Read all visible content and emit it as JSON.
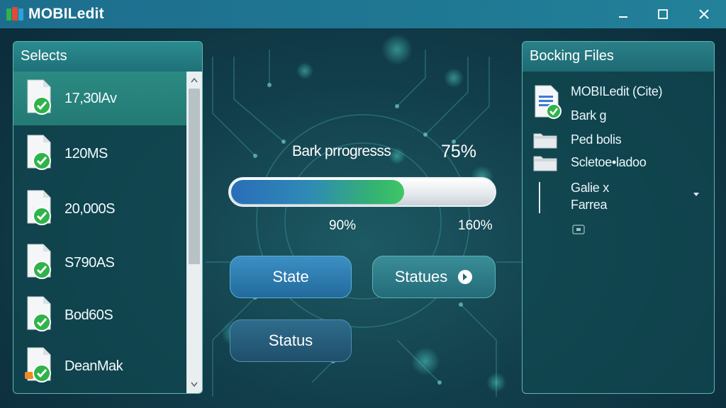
{
  "window": {
    "title": "MOBILedit",
    "controls": {
      "minimize": "minimize-icon",
      "maximize": "maximize-icon",
      "close": "close-icon"
    }
  },
  "left_panel": {
    "title": "Selects",
    "items": [
      {
        "label": "17,30lAv",
        "selected": true
      },
      {
        "label": "120MS",
        "selected": false
      },
      {
        "label": "20,000S",
        "selected": false
      },
      {
        "label": "S790AS",
        "selected": false
      },
      {
        "label": "Bod60S",
        "selected": false
      },
      {
        "label": "DeanMak",
        "selected": false
      }
    ]
  },
  "progress": {
    "label": "Bark prrogresss",
    "percent_text": "75%",
    "fill_fraction": 0.66,
    "tick_left": "90%",
    "tick_right": "160%"
  },
  "buttons": {
    "state": "State",
    "statues": "Statues",
    "status": "Status"
  },
  "right_panel": {
    "title": "Bocking Files",
    "items": [
      {
        "text": "MOBILedit (Cite)",
        "icon": "document-check-icon"
      },
      {
        "text": "Bark g",
        "icon": ""
      },
      {
        "text": "Ped bolis",
        "icon": "folder-icon"
      },
      {
        "text": "Scletoe•ladoo",
        "icon": "folder-icon"
      },
      {
        "text": "Galie x",
        "icon": "divider-icon"
      },
      {
        "text": "Farrea",
        "icon": ""
      }
    ],
    "dropdown": "chevron-down-icon"
  },
  "colors": {
    "accent_teal": "#2a8c8e",
    "progress_blue": "#2a6db8",
    "progress_green": "#3ec766",
    "check_green": "#2fb34a"
  }
}
